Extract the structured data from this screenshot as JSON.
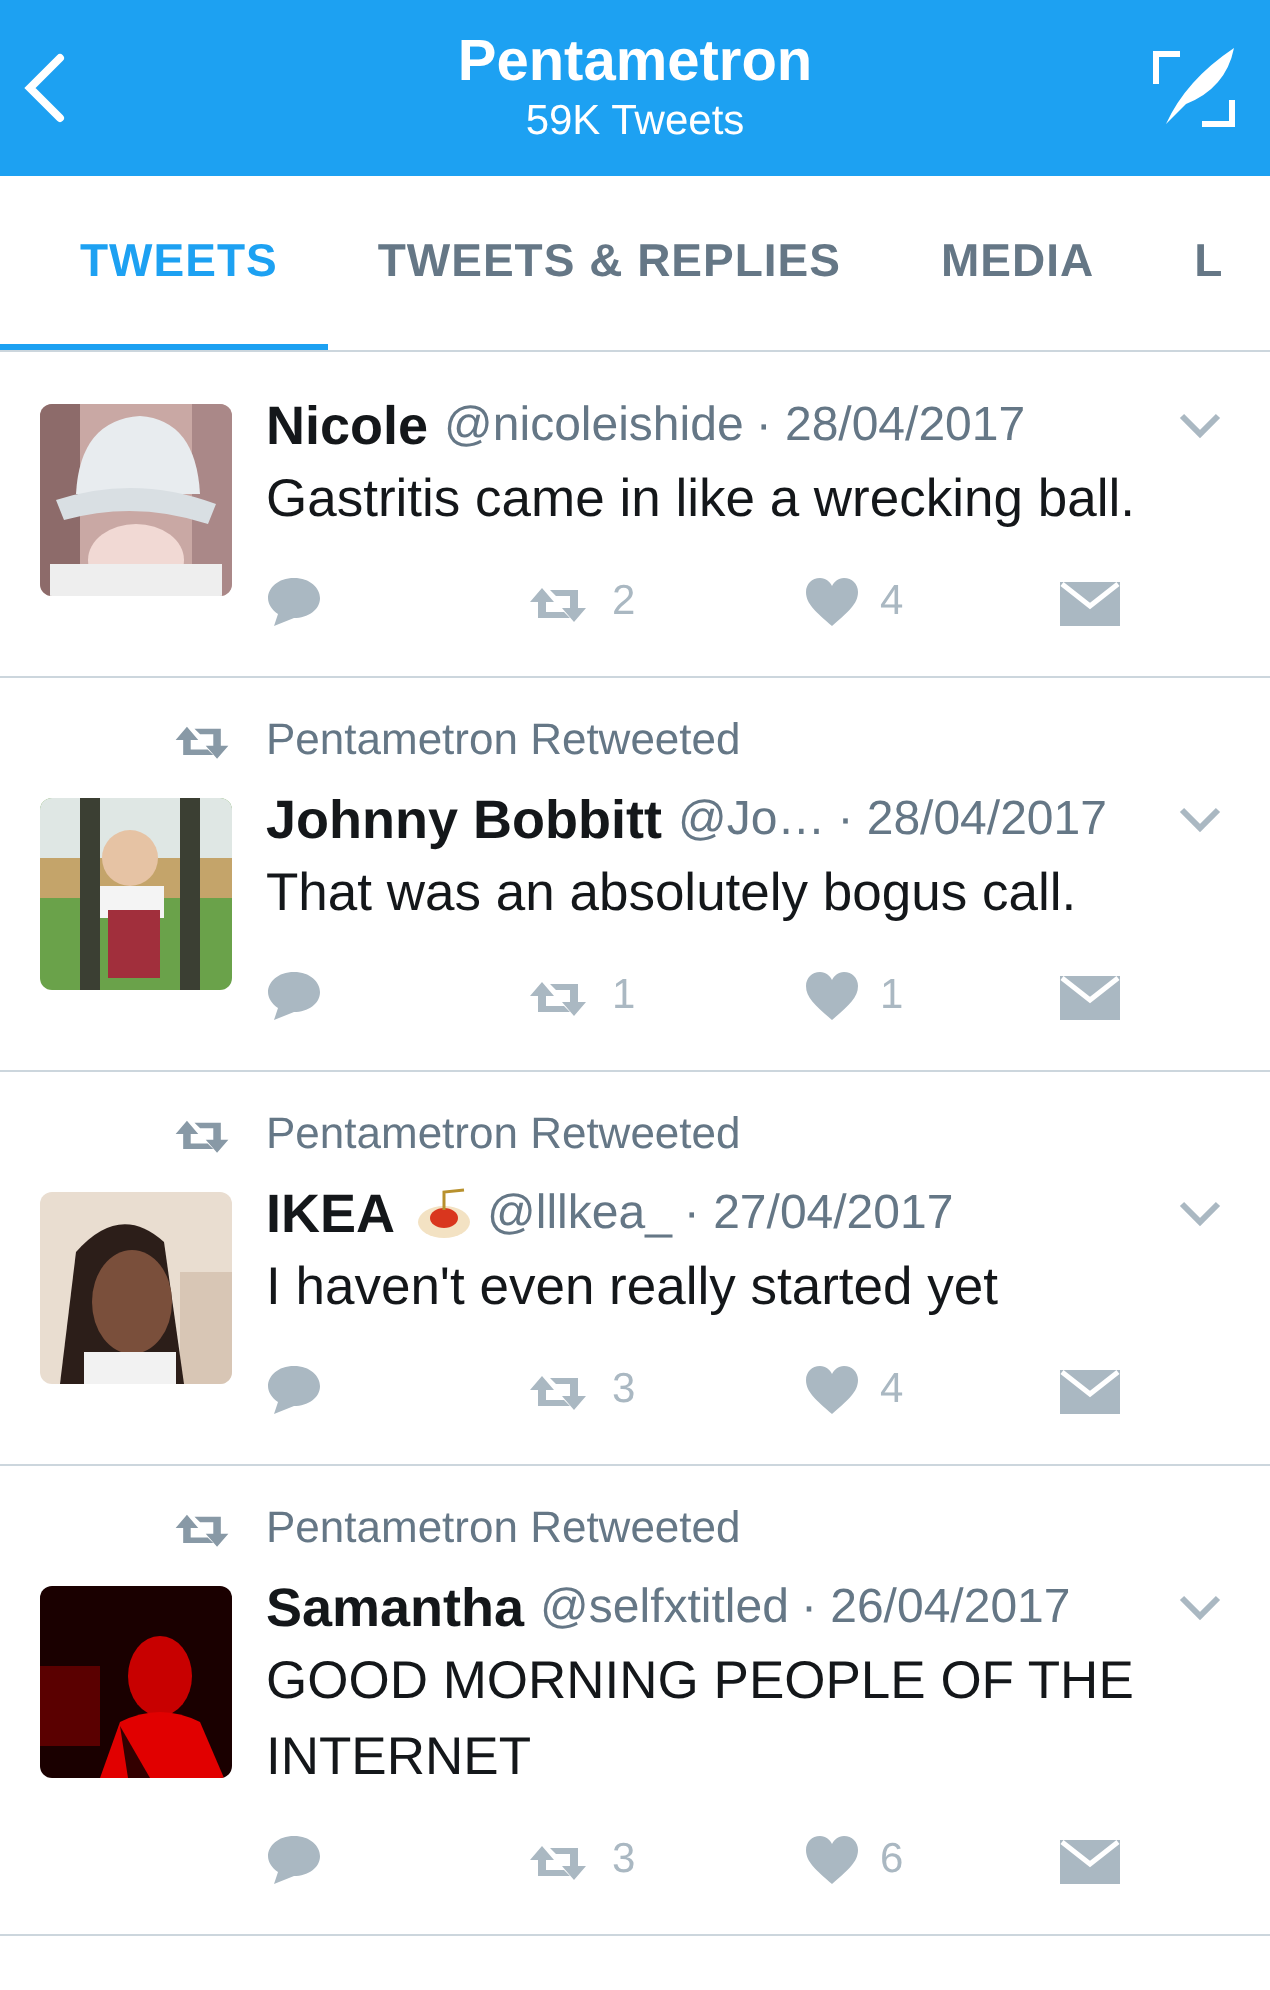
{
  "header": {
    "title": "Pentametron",
    "subtitle": "59K Tweets"
  },
  "tabs": [
    {
      "label": "TWEETS",
      "selected": true
    },
    {
      "label": "TWEETS & REPLIES",
      "selected": false
    },
    {
      "label": "MEDIA",
      "selected": false
    },
    {
      "label": "L",
      "selected": false
    }
  ],
  "tweets": [
    {
      "name": "Nicole",
      "name_icon": false,
      "handle": "@nicoleishide",
      "date": "· 28/04/2017",
      "text": "Gastritis came in like a wrecking ball.",
      "retweets": "2",
      "likes": "4"
    },
    {
      "retweeted_by": "Pentametron Retweeted",
      "name": "Johnny Bobbitt",
      "name_icon": false,
      "handle": "@Jo…",
      "date": "· 28/04/2017",
      "text": "That was an absolutely bogus call.",
      "retweets": "1",
      "likes": "1"
    },
    {
      "retweeted_by": "Pentametron Retweeted",
      "name": "IKEA",
      "name_icon": true,
      "handle": "@lllkea_",
      "date": "· 27/04/2017",
      "text": "I haven't even really started yet",
      "retweets": "3",
      "likes": "4"
    },
    {
      "retweeted_by": "Pentametron Retweeted",
      "name": "Samantha",
      "name_icon": false,
      "handle": "@selfxtitled",
      "date": "· 26/04/2017",
      "text": "GOOD MORNING PEOPLE OF THE INTERNET",
      "retweets": "3",
      "likes": "6"
    }
  ]
}
